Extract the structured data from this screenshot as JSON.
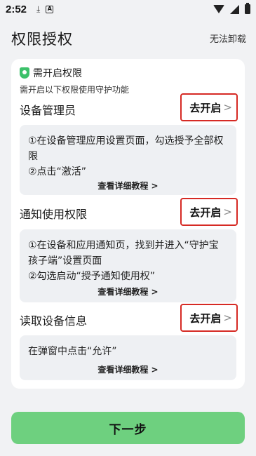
{
  "status_bar": {
    "time": "2:52",
    "icons": [
      "download-icon",
      "app-notification-icon",
      "wifi-icon",
      "signal-icon",
      "battery-icon"
    ]
  },
  "header": {
    "title": "权限授权",
    "action_label": "无法卸载"
  },
  "notice": {
    "title": "需开启权限",
    "subtitle": "需开启以下权限使用守护功能",
    "icon": "shield-icon",
    "icon_color": "#3cc16a"
  },
  "permissions": [
    {
      "title": "设备管理员",
      "button_label": "去开启",
      "chevron": ">",
      "steps": [
        "①在设备管理应用设置页面，勾选授予全部权限",
        "②点击“激活”"
      ],
      "link_label": "查看详细教程 >"
    },
    {
      "title": "通知使用权限",
      "button_label": "去开启",
      "chevron": ">",
      "steps": [
        "①在设备和应用通知页，找到并进入“守护宝孩子端”设置页面",
        "②勾选启动“授予通知使用权”"
      ],
      "link_label": "查看详细教程 >"
    },
    {
      "title": "读取设备信息",
      "button_label": "去开启",
      "chevron": ">",
      "steps": [
        "在弹窗中点击“允许”"
      ],
      "link_label": "查看详细教程 >"
    }
  ],
  "footer": {
    "next_label": "下一步",
    "next_color": "#6ed07f"
  },
  "colors": {
    "highlight_border": "#d62a24",
    "background": "#f1f2f4",
    "info_box": "#eef0f3"
  }
}
